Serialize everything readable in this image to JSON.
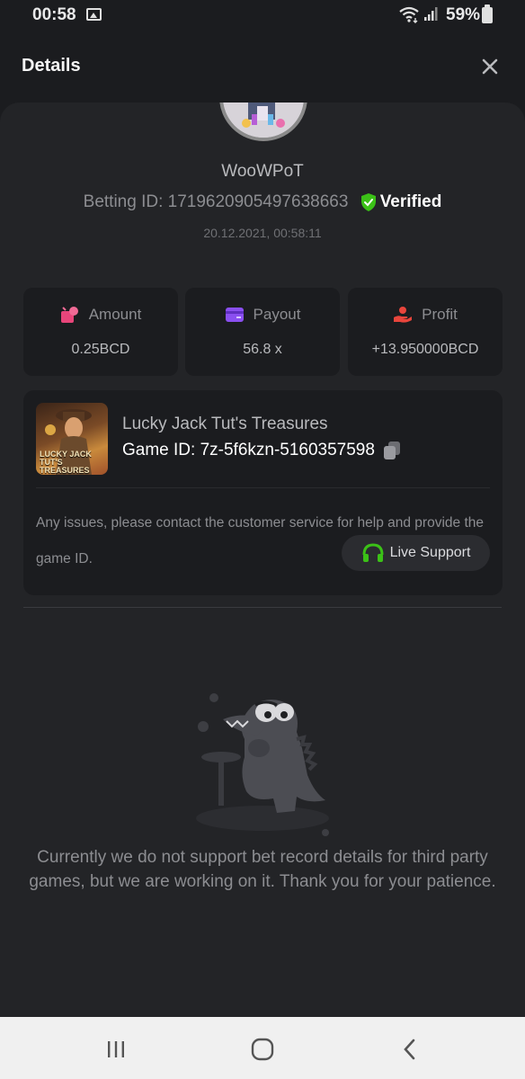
{
  "status_bar": {
    "time": "00:58",
    "battery": "59%",
    "icons": [
      "image-icon",
      "wifi-icon",
      "signal-icon",
      "battery-icon"
    ]
  },
  "header": {
    "title": "Details",
    "close_icon": "close-icon"
  },
  "profile": {
    "username": "WooWPoT",
    "betting_id": "Betting ID: 1719620905497638663",
    "verified_label": "Verified",
    "datetime": "20.12.2021, 00:58:11"
  },
  "stats": [
    {
      "label": "Amount",
      "value": "0.25BCD",
      "icon": "amount-icon",
      "color": "#e8457a"
    },
    {
      "label": "Payout",
      "value": "56.8 x",
      "icon": "payout-card-icon",
      "color": "#8a4ff0"
    },
    {
      "label": "Profit",
      "value": "+13.950000BCD",
      "icon": "profit-hand-icon",
      "color": "#e8453c"
    }
  ],
  "game": {
    "name": "Lucky Jack Tut's Treasures",
    "game_id": "Game ID: 7z-5f6kzn-5160357598",
    "thumb_text": "LUCKY JACK TUT'S TREASURES",
    "issue_text": "Any issues, please contact the customer service for help and provide the game ID.",
    "support_label": "Live Support"
  },
  "empty_state": {
    "message": "Currently we do not support bet record details for third party games, but we are working on it. Thank you for your patience."
  },
  "colors": {
    "background": "#1b1c1f",
    "panel": "#232427",
    "verified_green": "#3bc117",
    "support_green": "#3bc117"
  }
}
